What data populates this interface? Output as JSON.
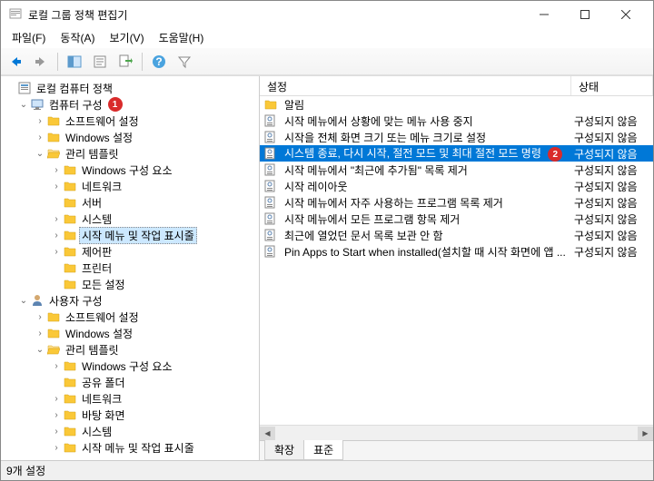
{
  "window": {
    "title": "로컬 그룹 정책 편집기"
  },
  "menu": {
    "file": "파일(F)",
    "action": "동작(A)",
    "view": "보기(V)",
    "help": "도움말(H)"
  },
  "tree": {
    "root": "로컬 컴퓨터 정책",
    "comp": "컴퓨터 구성",
    "sw1": "소프트웨어 설정",
    "win1": "Windows 설정",
    "admin1": "관리 템플릿",
    "wincomp1": "Windows 구성 요소",
    "network": "네트워크",
    "server": "서버",
    "system": "시스템",
    "startmenu": "시작 메뉴 및 작업 표시줄",
    "ctrlpanel": "제어판",
    "printer": "프린터",
    "allset": "모든 설정",
    "user": "사용자 구성",
    "sw2": "소프트웨어 설정",
    "win2": "Windows 설정",
    "admin2": "관리 템플릿",
    "wincomp2": "Windows 구성 요소",
    "shared": "공유 폴더",
    "network2": "네트워크",
    "desktop": "바탕 화면",
    "system2": "시스템",
    "startmenu2": "시작 메뉴 및 작업 표시줄"
  },
  "list": {
    "header_name": "설정",
    "header_state": "상태",
    "rows": [
      {
        "name": "알림",
        "state": "",
        "folder": true
      },
      {
        "name": "시작 메뉴에서 상황에 맞는 메뉴 사용 중지",
        "state": "구성되지 않음"
      },
      {
        "name": "시작을 전체 화면 크기 또는 메뉴 크기로 설정",
        "state": "구성되지 않음"
      },
      {
        "name": "시스템 종료, 다시 시작, 절전 모드 및 최대 절전 모드 명령",
        "state": "구성되지 않음",
        "selected": true
      },
      {
        "name": "시작 메뉴에서 \"최근에 추가됨\" 목록 제거",
        "state": "구성되지 않음"
      },
      {
        "name": "시작 레이아웃",
        "state": "구성되지 않음"
      },
      {
        "name": "시작 메뉴에서 자주 사용하는 프로그램 목록 제거",
        "state": "구성되지 않음"
      },
      {
        "name": "시작 메뉴에서 모든 프로그램 항목 제거",
        "state": "구성되지 않음"
      },
      {
        "name": "최근에 열었던 문서 목록 보관 안 함",
        "state": "구성되지 않음"
      },
      {
        "name": "Pin Apps to Start when installed(설치할 때 시작 화면에 앱 ...",
        "state": "구성되지 않음"
      }
    ]
  },
  "tabs": {
    "ext": "확장",
    "std": "표준"
  },
  "status": "9개 설정",
  "badges": {
    "one": "1",
    "two": "2"
  }
}
